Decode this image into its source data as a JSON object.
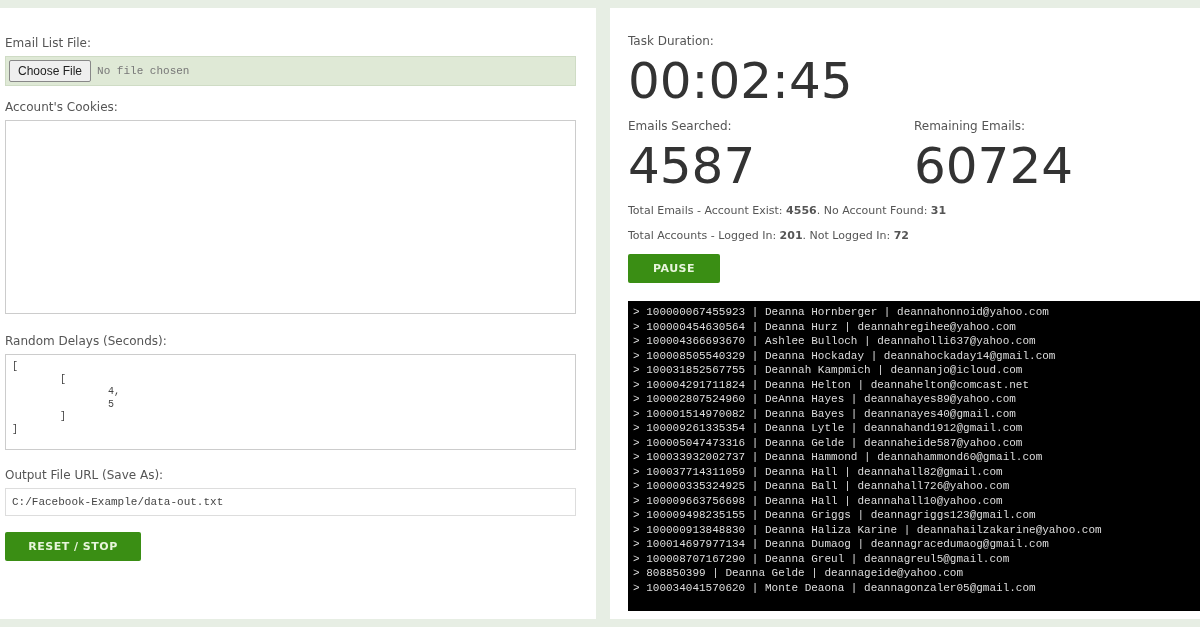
{
  "left_panel": {
    "email_list_file": {
      "label": "Email List File:",
      "button": "Choose File",
      "status": "No file chosen"
    },
    "cookies": {
      "label": "Account's Cookies:"
    },
    "random_delays": {
      "label": "Random Delays (Seconds):",
      "value": "[\n        [\n                4,\n                5\n        ]\n]"
    },
    "output_file": {
      "label": "Output File URL (Save As):",
      "value": "C:/Facebook-Example/data-out.txt"
    },
    "reset_button": "RESET / STOP"
  },
  "right_panel": {
    "task_duration": {
      "label": "Task Duration:",
      "value": "00:02:45"
    },
    "emails_searched": {
      "label": "Emails Searched:",
      "value": "4587"
    },
    "remaining_emails": {
      "label": "Remaining Emails:",
      "value": "60724"
    },
    "summary": [
      "Total Emails - Account Exist: **4556**. No Account Found: **31**",
      "Total Accounts - Logged In: **201**. Not Logged In: **72**"
    ],
    "pause_button": "PAUSE",
    "log": [
      "> 100000067455923 | Deanna Hornberger | deannahonnoid@yahoo.com",
      "> 100000454630564 | Deanna Hurz | deannahregihee@yahoo.com",
      "> 100004366693670 | Ashlee Bulloch | deannaholli637@yahoo.com",
      "> 100008505540329 | Deanna Hockaday | deannahockaday14@gmail.com",
      "> 100031852567755 | Deannah Kampmich | deannanjo@icloud.com",
      "> 100004291711824 | Deanna Helton | deannahelton@comcast.net",
      "> 100002807524960 | DeAnna Hayes | deannahayes89@yahoo.com",
      "> 100001514970082 | Deanna Bayes | deannanayes40@gmail.com",
      "> 100009261335354 | Deanna Lytle | deannahand1912@gmail.com",
      "> 100005047473316 | Deanna Gelde | deannaheide587@yahoo.com",
      "> 100033932002737 | Deanna Hammond | deannahammond60@gmail.com",
      "> 100037714311059 | Deanna Hall | deannahall82@gmail.com",
      "> 100000335324925 | Deanna Ball | deannahall726@yahoo.com",
      "> 100009663756698 | Deanna Hall | deannahall10@yahoo.com",
      "> 100009498235155 | Deanna Griggs | deannagriggs123@gmail.com",
      "> 100000913848830 | Deanna Haliza Karine | deannahailzakarine@yahoo.com",
      "> 100014697977134 | Deanna Dumaog | deannagracedumaog@gmail.com",
      "> 100008707167290 | Deanna Greul | deannagreul5@gmail.com",
      "> 808850399 | Deanna Gelde | deannageide@yahoo.com",
      "> 100034041570620 | Monte Deaona | deannagonzaler05@gmail.com"
    ]
  }
}
